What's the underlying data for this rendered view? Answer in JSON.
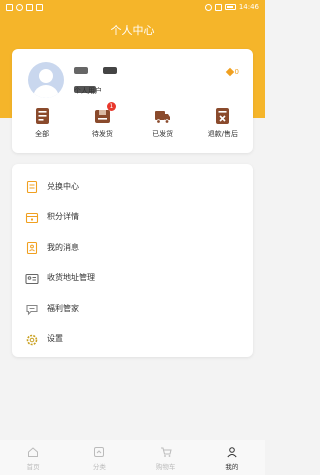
{
  "status_bar": {
    "time": "14:46"
  },
  "page": {
    "title": "个人中心"
  },
  "profile": {
    "level": "个人用户",
    "points": "0"
  },
  "orders": [
    {
      "label": "全部",
      "icon": "order-list-icon",
      "badge": ""
    },
    {
      "label": "待发货",
      "icon": "pending-ship-icon",
      "badge": "1"
    },
    {
      "label": "已发货",
      "icon": "shipped-truck-icon",
      "badge": ""
    },
    {
      "label": "退款/售后",
      "icon": "refund-icon",
      "badge": ""
    }
  ],
  "menu": [
    {
      "label": "兑换中心",
      "icon": "exchange-icon"
    },
    {
      "label": "积分详情",
      "icon": "points-detail-icon"
    },
    {
      "label": "我的消息",
      "icon": "message-icon"
    },
    {
      "label": "收货地址管理",
      "icon": "address-icon"
    },
    {
      "label": "福利管家",
      "icon": "welfare-icon"
    },
    {
      "label": "设置",
      "icon": "settings-icon"
    }
  ],
  "tabs": [
    {
      "label": "首页",
      "icon": "home-icon",
      "active": false
    },
    {
      "label": "分类",
      "icon": "category-icon",
      "active": false
    },
    {
      "label": "购物车",
      "icon": "cart-icon",
      "active": false
    },
    {
      "label": "我的",
      "icon": "user-icon",
      "active": true
    }
  ],
  "colors": {
    "accent": "#f5b52a",
    "badge": "#e8382c",
    "icon_brown": "#8a4a2c"
  }
}
